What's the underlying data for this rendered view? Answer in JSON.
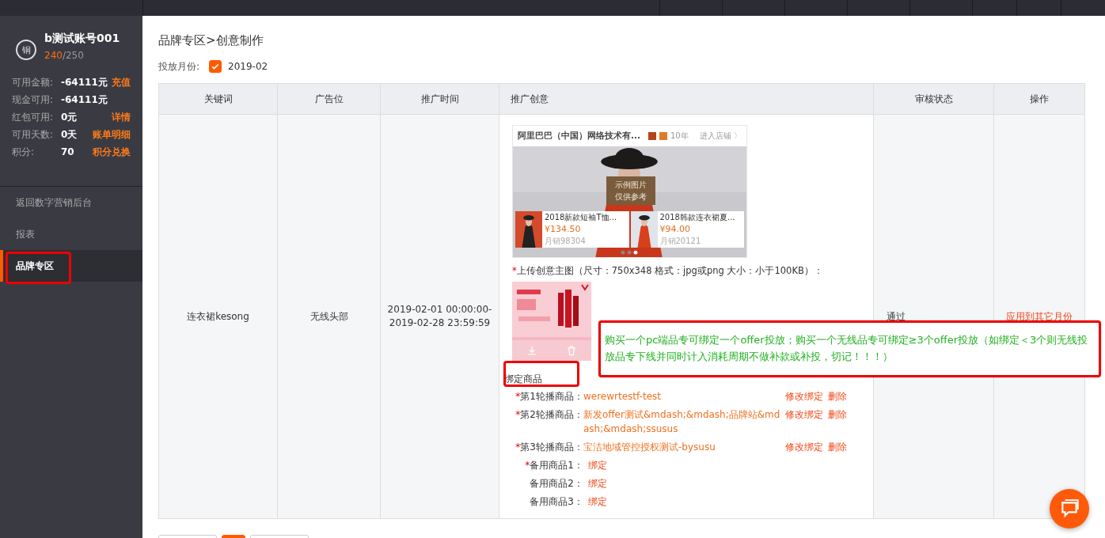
{
  "account": {
    "badge": "铜",
    "name": "b测试账号001",
    "points": "240",
    "points_total": "/250"
  },
  "stats": [
    {
      "label": "可用金额:",
      "value": "-64111元",
      "link": "充值"
    },
    {
      "label": "现金可用:",
      "value": "-64111元"
    },
    {
      "label": "红包可用:",
      "value": "0元",
      "link": "详情"
    },
    {
      "label": "可用天数:",
      "value": "0天",
      "link": "账单明细"
    },
    {
      "label": "积分:",
      "value": "70",
      "link": "积分兑换"
    }
  ],
  "nav": [
    {
      "label": "返回数字营销后台",
      "selected": false
    },
    {
      "label": "报表",
      "selected": false
    },
    {
      "label": "品牌专区",
      "selected": true
    }
  ],
  "breadcrumb": "品牌专区>创意制作",
  "month": {
    "label": "投放月份:",
    "checked": true,
    "value": "2019-02"
  },
  "table": {
    "columns": [
      "关键词",
      "广告位",
      "推广时间",
      "推广创意",
      "审核状态",
      "操作"
    ],
    "rows": [
      {
        "keyword": "连衣裙kesong",
        "slot": "无线头部",
        "time": [
          "2019-02-01 00:00:00-",
          "2019-02-28 23:59:59"
        ],
        "preview": {
          "shop": "阿里巴巴（中国）网络技术有...",
          "years": "10年",
          "enter": "进入店铺 〉",
          "overlay": [
            "示例图片",
            "仅供参考"
          ],
          "products": [
            {
              "title": "2018新款短袖T恤...",
              "price": "¥134.50",
              "sales": "月销98304"
            },
            {
              "title": "2018韩款连衣裙夏...",
              "price": "¥94.00",
              "sales": "月销20121"
            }
          ]
        },
        "upload_mark": "*",
        "upload_label": "上传创意主图（尺寸：750x348 格式：jpg或png 大小：小于100KB）：",
        "bind_title": "绑定商品",
        "bindings": [
          {
            "kind": "bound",
            "mark": "*",
            "label": "第1轮播商品：",
            "value": "werewrtestf-test",
            "actions": [
              "修改绑定",
              "删除"
            ]
          },
          {
            "kind": "bound",
            "mark": "*",
            "label": "第2轮播商品：",
            "value": "新发offer测试&mdash;&mdash;品牌站&mdash;&mdash;ssusus",
            "actions": [
              "修改绑定",
              "删除"
            ]
          },
          {
            "kind": "bound",
            "mark": "*",
            "label": "第3轮播商品：",
            "value": "宝洁地域管控授权测试-bysusu",
            "actions": [
              "修改绑定",
              "删除"
            ]
          },
          {
            "kind": "empty",
            "mark": "*",
            "label": "备用商品1：",
            "link": "绑定"
          },
          {
            "kind": "empty",
            "label": "备用商品2：",
            "link": "绑定"
          },
          {
            "kind": "empty",
            "label": "备用商品3：",
            "link": "绑定"
          }
        ],
        "status": "通过",
        "action": "应用到其它月份"
      }
    ]
  },
  "note": "购买一个pc端品专可绑定一个offer投放；购买一个无线品专可绑定≥3个offer投放（如绑定＜3个则无线投放品专下线并同时计入消耗周期不做补款或补投，切记！！！）"
}
